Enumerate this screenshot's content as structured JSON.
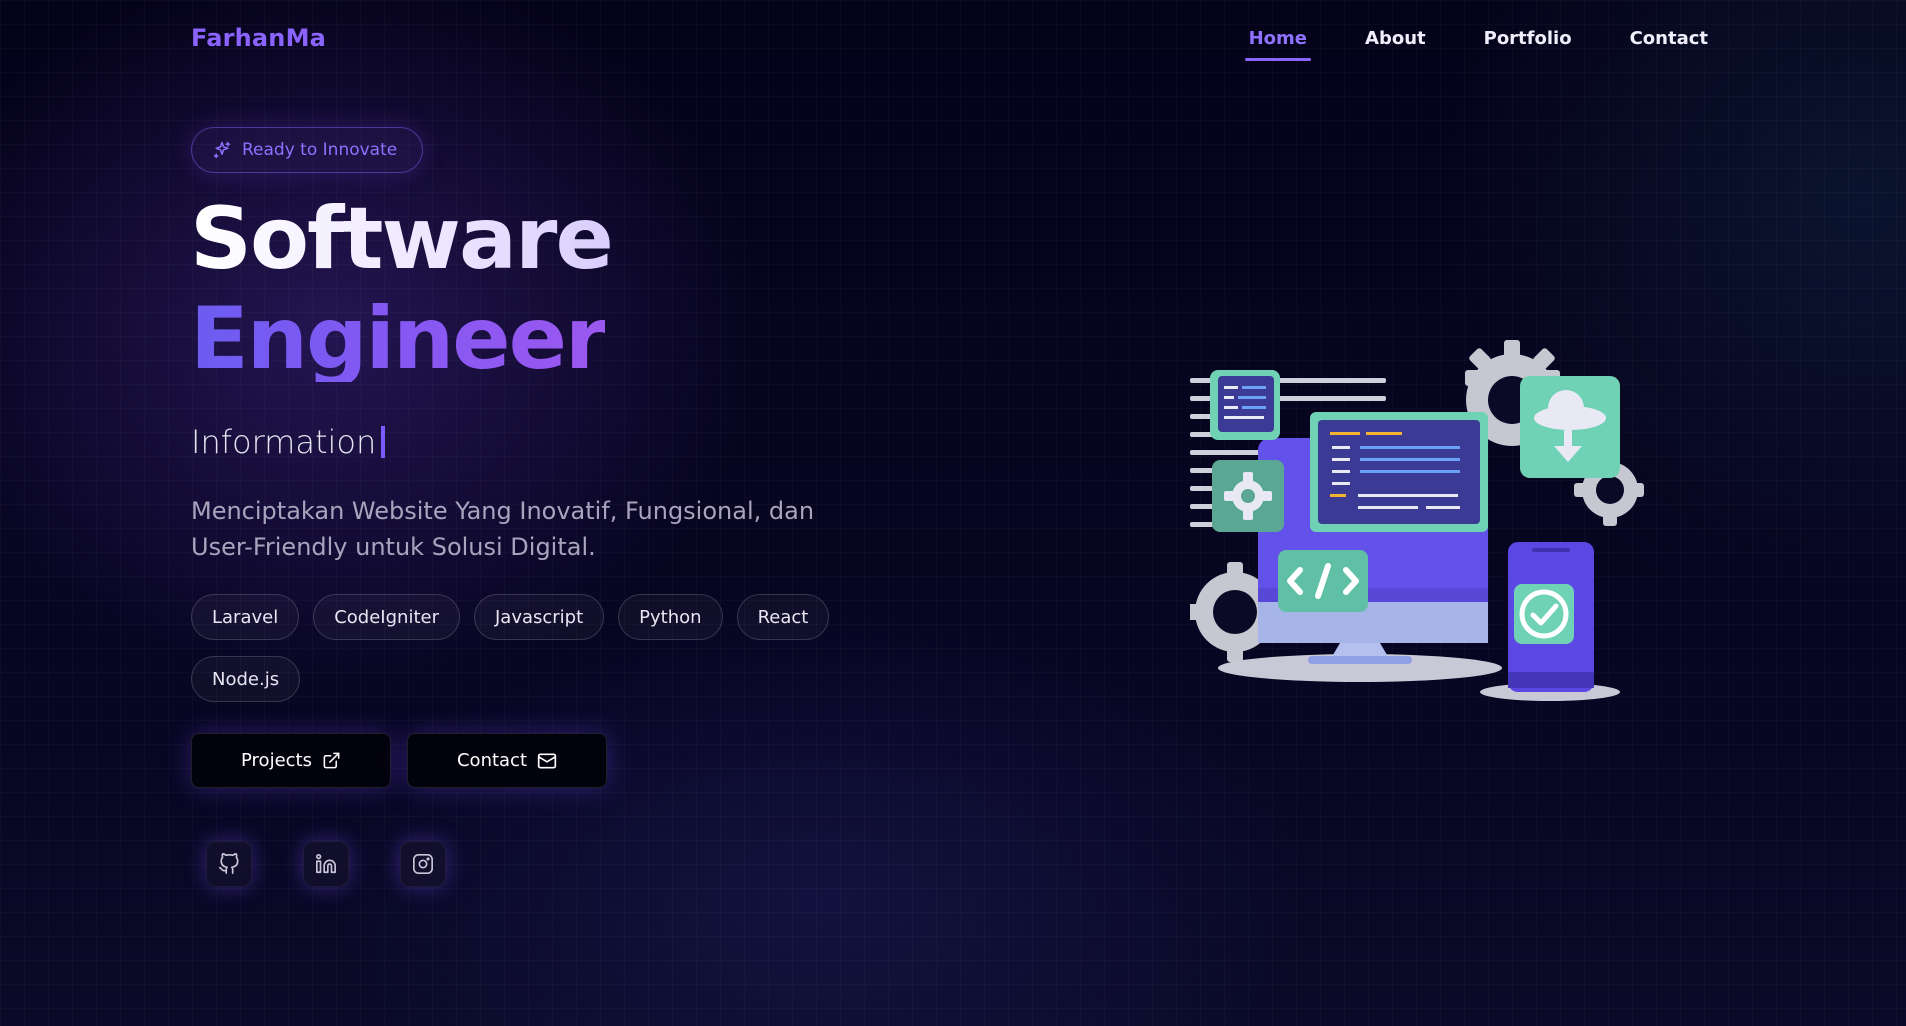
{
  "brand": {
    "logo": "FarhanMa"
  },
  "nav": {
    "items": [
      {
        "label": "Home",
        "active": true
      },
      {
        "label": "About",
        "active": false
      },
      {
        "label": "Portfolio",
        "active": false
      },
      {
        "label": "Contact",
        "active": false
      }
    ]
  },
  "hero": {
    "badge": "Ready to Innovate",
    "title_line1": "Software",
    "title_line2": "Engineer",
    "typing_text": "Information",
    "description": "Menciptakan Website Yang Inovatif, Fungsional, dan User-Friendly untuk Solusi Digital.",
    "tags": [
      "Laravel",
      "CodeIgniter",
      "Javascript",
      "Python",
      "React",
      "Node.js"
    ],
    "buttons": {
      "projects": "Projects",
      "contact": "Contact"
    }
  },
  "social": {
    "icons": [
      "github-icon",
      "linkedin-icon",
      "instagram-icon"
    ]
  },
  "colors": {
    "accent": "#8b63ff",
    "background": "#050316",
    "engineer_gradient_start": "#6c5cf0",
    "engineer_gradient_end": "#9b58ef"
  }
}
